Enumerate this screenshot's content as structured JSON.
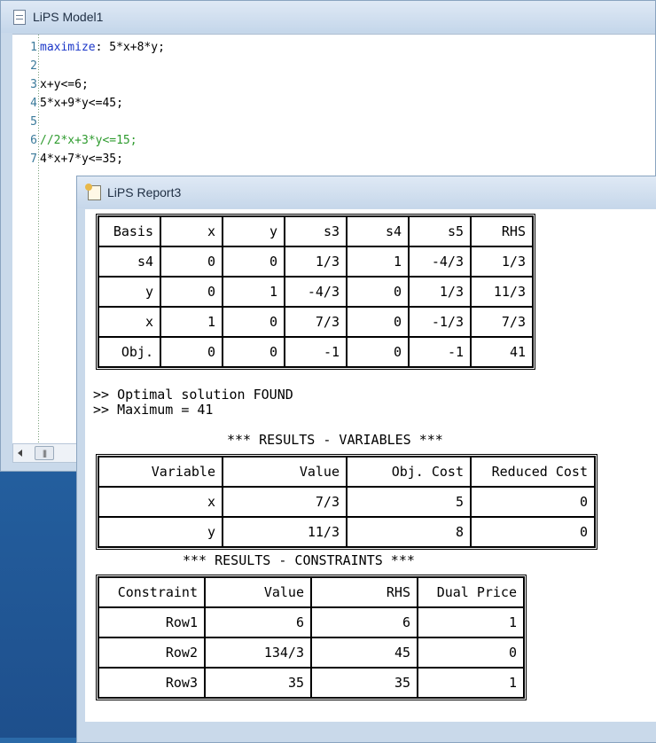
{
  "model_window": {
    "title": "LiPS Model1",
    "lines": [
      {
        "num": "1",
        "parts": [
          {
            "t": "maximize",
            "c": "kw"
          },
          {
            "t": ": 5*x+8*y;",
            "c": ""
          }
        ]
      },
      {
        "num": "2",
        "parts": []
      },
      {
        "num": "3",
        "parts": [
          {
            "t": "x+y<=6;",
            "c": ""
          }
        ]
      },
      {
        "num": "4",
        "parts": [
          {
            "t": "5*x+9*y<=45;",
            "c": ""
          }
        ]
      },
      {
        "num": "5",
        "parts": []
      },
      {
        "num": "6",
        "parts": [
          {
            "t": "//2*x+3*y<=15;",
            "c": "cm"
          }
        ]
      },
      {
        "num": "7",
        "parts": [
          {
            "t": "4*x+7*y<=35;",
            "c": ""
          }
        ]
      }
    ]
  },
  "report_window": {
    "title": "LiPS Report3",
    "simplex_table": {
      "header": [
        "Basis",
        "x",
        "y",
        "s3",
        "s4",
        "s5",
        "RHS"
      ],
      "rows": [
        [
          "s4",
          "0",
          "0",
          "1/3",
          "1",
          "-4/3",
          "1/3"
        ],
        [
          "y",
          "0",
          "1",
          "-4/3",
          "0",
          "1/3",
          "11/3"
        ],
        [
          "x",
          "1",
          "0",
          "7/3",
          "0",
          "-1/3",
          "7/3"
        ],
        [
          "Obj.",
          "0",
          "0",
          "-1",
          "0",
          "-1",
          "41"
        ]
      ]
    },
    "messages": [
      ">> Optimal solution FOUND",
      ">> Maximum = 41"
    ],
    "variables_title": "*** RESULTS - VARIABLES ***",
    "variables_table": {
      "header": [
        "Variable",
        "Value",
        "Obj. Cost",
        "Reduced Cost"
      ],
      "rows": [
        [
          "x",
          "7/3",
          "5",
          "0"
        ],
        [
          "y",
          "11/3",
          "8",
          "0"
        ]
      ]
    },
    "constraints_title": "*** RESULTS - CONSTRAINTS ***",
    "constraints_table": {
      "header": [
        "Constraint",
        "Value",
        "RHS",
        "Dual Price"
      ],
      "rows": [
        [
          "Row1",
          "6",
          "6",
          "1"
        ],
        [
          "Row2",
          "134/3",
          "45",
          "0"
        ],
        [
          "Row3",
          "35",
          "35",
          "1"
        ]
      ]
    }
  }
}
